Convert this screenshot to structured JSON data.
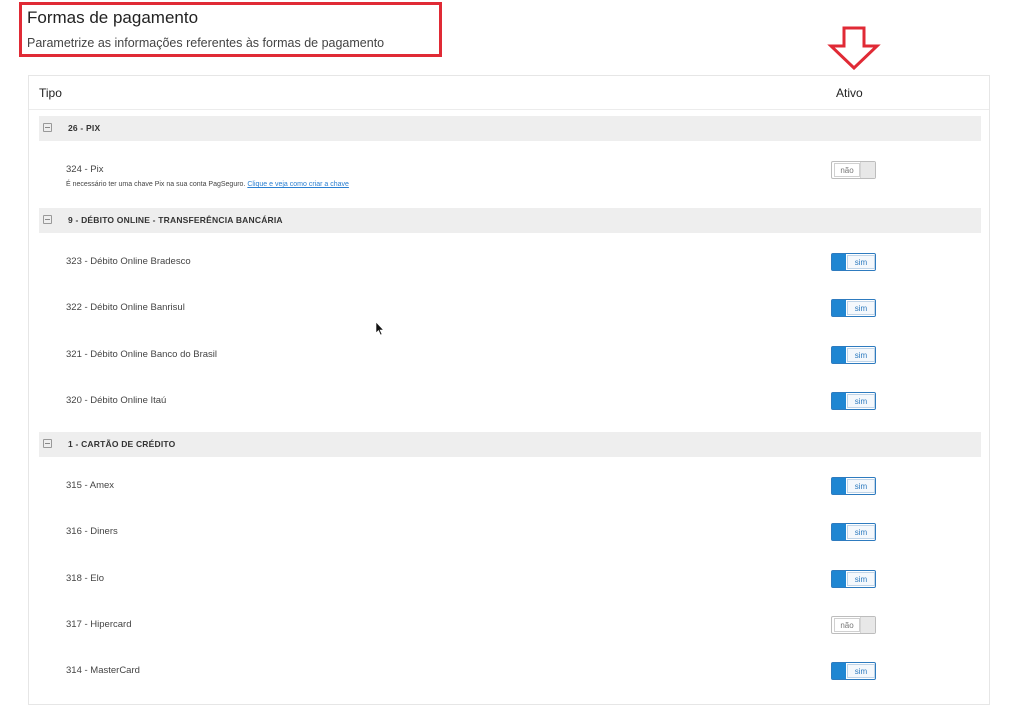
{
  "header": {
    "title": "Formas de pagamento",
    "subtitle": "Parametrize as informações referentes às formas de pagamento"
  },
  "table": {
    "col_tipo": "Tipo",
    "col_ativo": "Ativo"
  },
  "groups": [
    {
      "label": "26 - PIX",
      "items": [
        {
          "label": "324 - Pix",
          "note": "É necessário ter uma chave Pix na sua conta PagSeguro.",
          "note_link": "Clique e veja como criar a chave",
          "toggle": "não",
          "active": false
        }
      ]
    },
    {
      "label": "9 - DÉBITO ONLINE - TRANSFERÊNCIA BANCÁRIA",
      "items": [
        {
          "label": "323 - Débito Online Bradesco",
          "toggle": "sim",
          "active": true
        },
        {
          "label": "322 - Débito Online Banrisul",
          "toggle": "sim",
          "active": true
        },
        {
          "label": "321 - Débito Online Banco do Brasil",
          "toggle": "sim",
          "active": true
        },
        {
          "label": "320 - Débito Online Itaú",
          "toggle": "sim",
          "active": true
        }
      ]
    },
    {
      "label": "1 - CARTÃO DE CRÉDITO",
      "items": [
        {
          "label": "315 - Amex",
          "toggle": "sim",
          "active": true
        },
        {
          "label": "316 - Diners",
          "toggle": "sim",
          "active": true
        },
        {
          "label": "318 - Elo",
          "toggle": "sim",
          "active": true
        },
        {
          "label": "317 - Hipercard",
          "toggle": "não",
          "active": false
        },
        {
          "label": "314 - MasterCard",
          "toggle": "sim",
          "active": true
        }
      ]
    }
  ],
  "colors": {
    "highlight_box": "#e02a35",
    "arrow": "#e02a35",
    "toggle_on": "#1f86d2",
    "link": "#2a7fd1"
  },
  "icons": {
    "annotation_arrow": "arrow-down-icon",
    "group_collapse": "minus-square-icon",
    "cursor": "mouse-pointer-icon"
  }
}
